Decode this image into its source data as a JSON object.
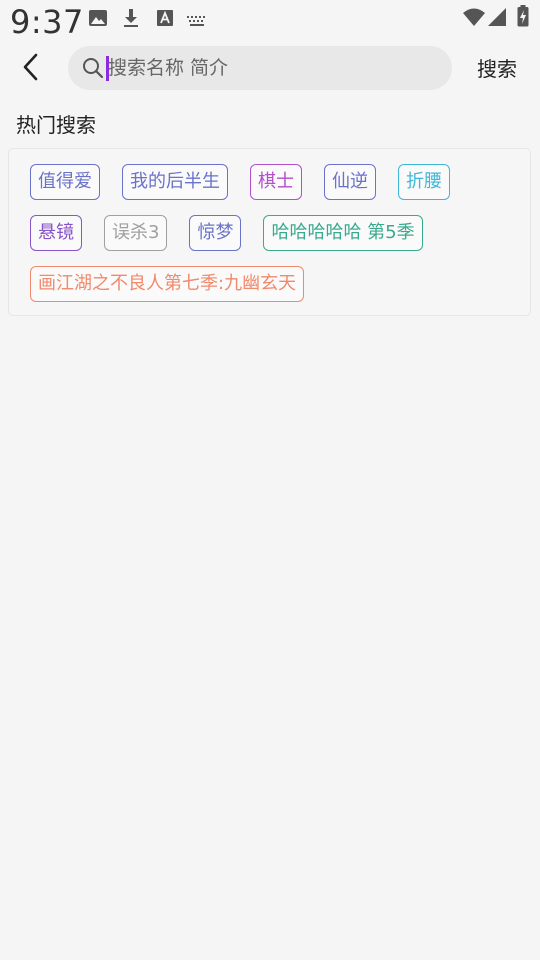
{
  "status_bar": {
    "time": "9:37",
    "icons": [
      "image-icon",
      "download-icon",
      "font-icon",
      "keyboard-icon",
      "wifi-icon",
      "signal-icon",
      "battery-icon"
    ]
  },
  "search": {
    "placeholder": "搜索名称 简介",
    "value": "",
    "button_label": "搜索"
  },
  "hot_search": {
    "title": "热门搜索",
    "tags": [
      {
        "label": "值得爱",
        "color": "#6b72c9"
      },
      {
        "label": "我的后半生",
        "color": "#6b72c9"
      },
      {
        "label": "棋士",
        "color": "#b24fc9"
      },
      {
        "label": "仙逆",
        "color": "#6b72c9"
      },
      {
        "label": "折腰",
        "color": "#3fb8d8"
      },
      {
        "label": "悬镜",
        "color": "#8a55c9"
      },
      {
        "label": "误杀3",
        "color": "#a0a0a0"
      },
      {
        "label": "惊梦",
        "color": "#6b72c9"
      },
      {
        "label": "哈哈哈哈哈 第5季",
        "color": "#3aaa8e"
      },
      {
        "label": "画江湖之不良人第七季:九幽玄天",
        "color": "#f08a6c"
      }
    ]
  },
  "colors": {
    "background": "#f5f5f5",
    "search_box": "#e8e8e8",
    "caret": "#8a2be2"
  }
}
